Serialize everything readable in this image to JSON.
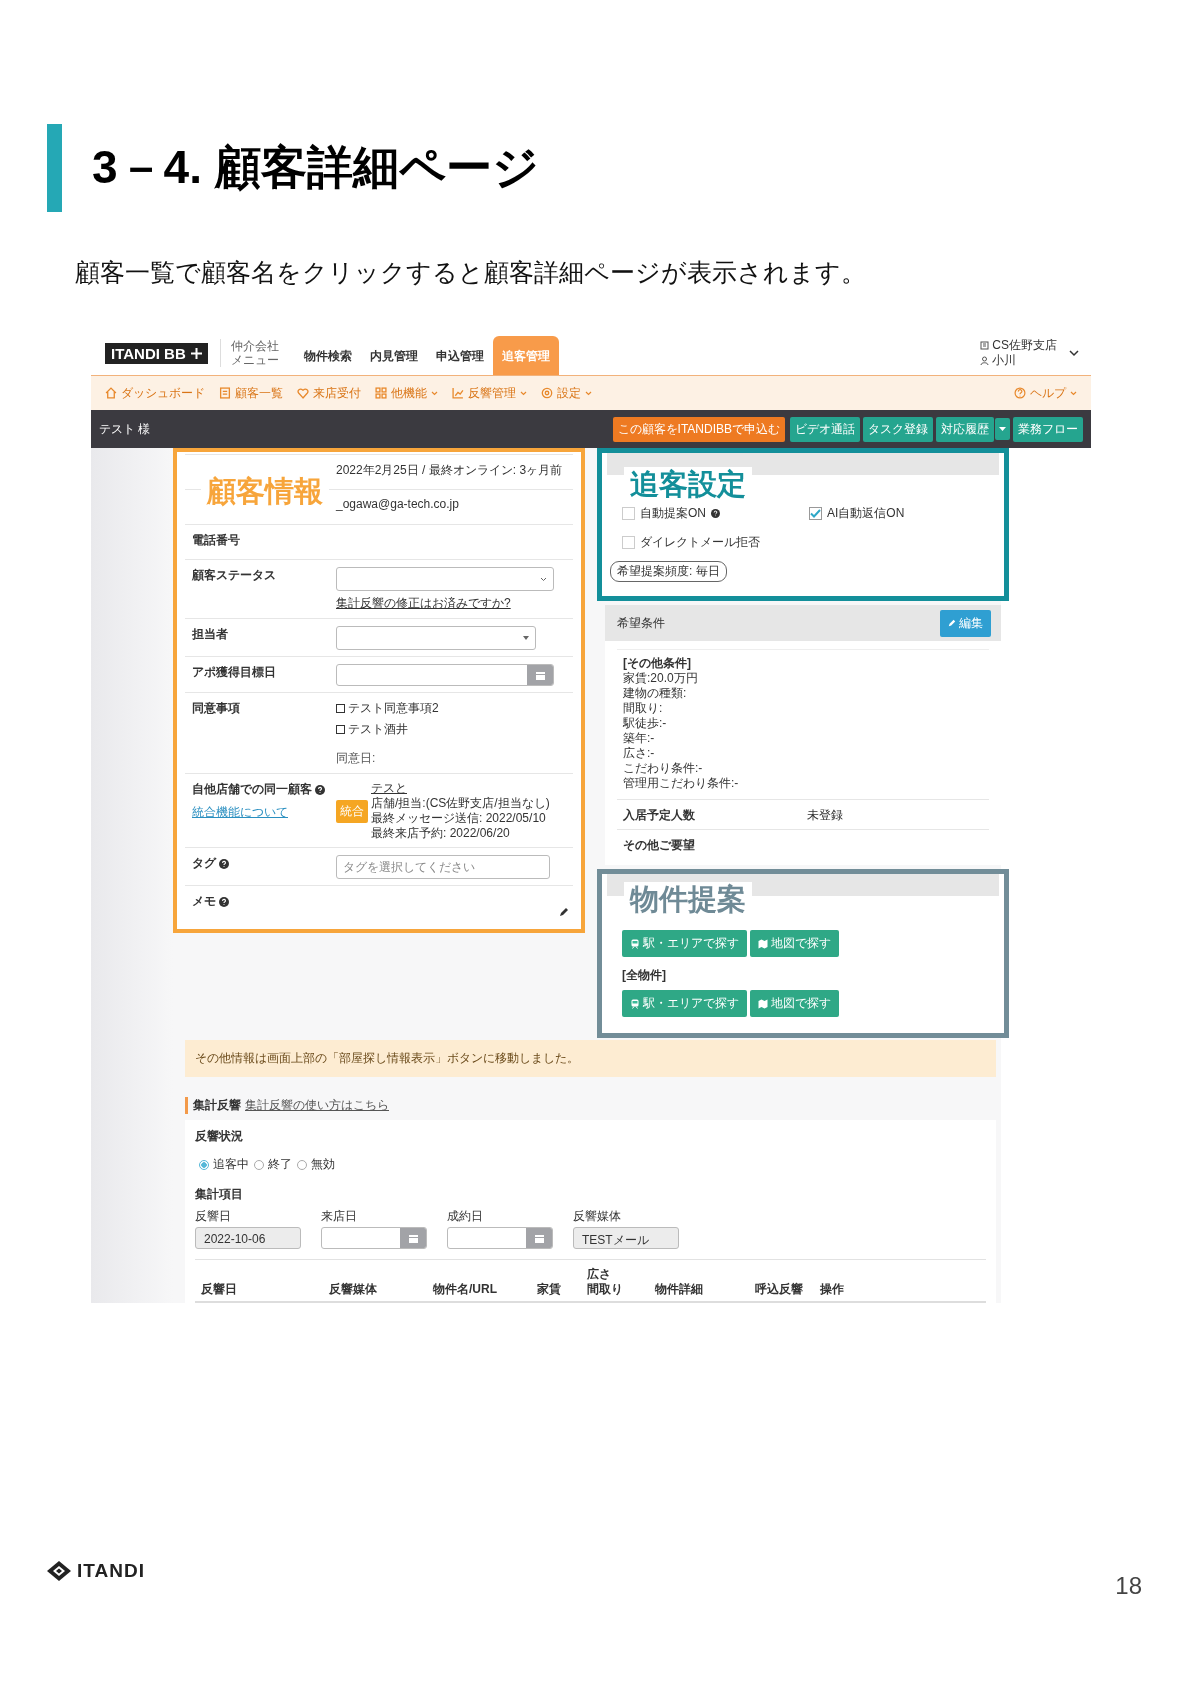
{
  "slide": {
    "title": "3－4. 顧客詳細ページ",
    "lead": "顧客一覧で顧客名をクリックすると顧客詳細ページが表示されます。"
  },
  "app": {
    "logo": "ITANDI BB",
    "company_menu": [
      "仲介会社",
      "メニュー"
    ],
    "main_tabs": [
      {
        "label": "物件検索",
        "selected": false
      },
      {
        "label": "内見管理",
        "selected": false
      },
      {
        "label": "申込管理",
        "selected": false
      },
      {
        "label": "追客管理",
        "selected": true
      }
    ],
    "store": "CS佐野支店",
    "user": "小川",
    "sub_nav": [
      {
        "label": "ダッシュボード"
      },
      {
        "label": "顧客一覧"
      },
      {
        "label": "来店受付"
      },
      {
        "label": "他機能",
        "has_menu": true
      },
      {
        "label": "反響管理",
        "has_menu": true
      },
      {
        "label": "設定",
        "has_menu": true
      }
    ],
    "help": "ヘルプ",
    "customer_name": "テスト 様",
    "actions": [
      {
        "label": "この顧客をITANDIBBで申込む",
        "kind": "primary"
      },
      {
        "label": "ビデオ通話",
        "kind": "default"
      },
      {
        "label": "タスク登録",
        "kind": "default"
      },
      {
        "label": "対応履歴",
        "kind": "default",
        "dropdown": true
      },
      {
        "label": "業務フロー",
        "kind": "default"
      }
    ]
  },
  "customer_info": {
    "overlay": "顧客情報",
    "rows": [
      {
        "kind": "text",
        "value": "2022年2月25日 / 最終オンライン: 3ヶ月前"
      },
      {
        "kind": "text",
        "value": "_ogawa@ga-tech.co.jp"
      },
      {
        "kind": "text",
        "label": "電話番号"
      },
      {
        "kind": "select",
        "label": "顧客ステータス",
        "link": "集計反響の修正はお済みですか?"
      },
      {
        "kind": "select",
        "label": "担当者"
      },
      {
        "kind": "date",
        "label": "アポ獲得目標日"
      },
      {
        "kind": "consents",
        "label": "同意事項",
        "options": [
          {
            "label": "テスト同意事項2",
            "checked": false
          },
          {
            "label": "テスト酒井",
            "checked": false
          }
        ],
        "note": "同意日:"
      },
      {
        "kind": "duplicate",
        "label": "自他店舗での同一顧客",
        "help": true,
        "link": "統合機能について",
        "badge": "統合",
        "name": "テスと",
        "details": [
          "店舗/担当:(CS佐野支店/担当なし)",
          "最終メッセージ送信: 2022/05/10",
          "最終来店予約: 2022/06/20"
        ]
      },
      {
        "kind": "tag",
        "label": "タグ",
        "help": true,
        "placeholder": "タグを選択してください"
      },
      {
        "kind": "memo",
        "label": "メモ",
        "help": true
      }
    ]
  },
  "follow_up": {
    "overlay": "追客設定",
    "options": [
      {
        "label": "自動提案ON",
        "checked": false,
        "help": true
      },
      {
        "label": "AI自動返信ON",
        "checked": true
      },
      {
        "label": "ダイレクトメール拒否",
        "checked": false
      }
    ],
    "frequency": "希望提案頻度: 毎日"
  },
  "preferences": {
    "title": "希望条件",
    "edit": "編集",
    "group_title": "[その他条件]",
    "lines": [
      "家賃:20.0万円",
      "建物の種類:",
      "間取り:",
      "駅徒歩:-",
      "築年:-",
      "広さ:-",
      "こだわり条件:-",
      "管理用こだわり条件:-"
    ],
    "rows": [
      {
        "label": "入居予定人数",
        "value": "未登録"
      },
      {
        "label": "その他ご要望"
      }
    ]
  },
  "proposals": {
    "overlay": "物件提案",
    "groups": [
      {
        "buttons": [
          "駅・エリアで探す",
          "地図で探す"
        ]
      },
      {
        "title": "[全物件]",
        "buttons": [
          "駅・エリアで探す",
          "地図で探す"
        ]
      }
    ]
  },
  "notice": "その他情報は画面上部の「部屋探し情報表示」ボタンに移動しました。",
  "aggregation": {
    "title": "集計反響",
    "link": "集計反響の使い方はこちら",
    "status_label": "反響状況",
    "statuses": [
      {
        "label": "追客中",
        "selected": true
      },
      {
        "label": "終了",
        "selected": false
      },
      {
        "label": "無効",
        "selected": false
      }
    ],
    "items_label": "集計項目",
    "fields": [
      {
        "label": "反響日",
        "kind": "readonly",
        "value": "2022-10-06"
      },
      {
        "label": "来店日",
        "kind": "date"
      },
      {
        "label": "成約日",
        "kind": "date"
      },
      {
        "label": "反響媒体",
        "kind": "readonly",
        "value": "TESTメール"
      }
    ],
    "columns": [
      {
        "lines": [
          "反響日"
        ]
      },
      {
        "lines": [
          "反響媒体"
        ]
      },
      {
        "lines": [
          "物件名/URL"
        ]
      },
      {
        "lines": [
          "家賃"
        ]
      },
      {
        "lines": [
          "広さ",
          "間取り"
        ]
      },
      {
        "lines": [
          "物件詳細"
        ]
      },
      {
        "lines": [
          "呼込反響"
        ]
      },
      {
        "lines": [
          "操作"
        ]
      }
    ]
  },
  "footer": {
    "logo": "ITANDI",
    "page": "18"
  }
}
